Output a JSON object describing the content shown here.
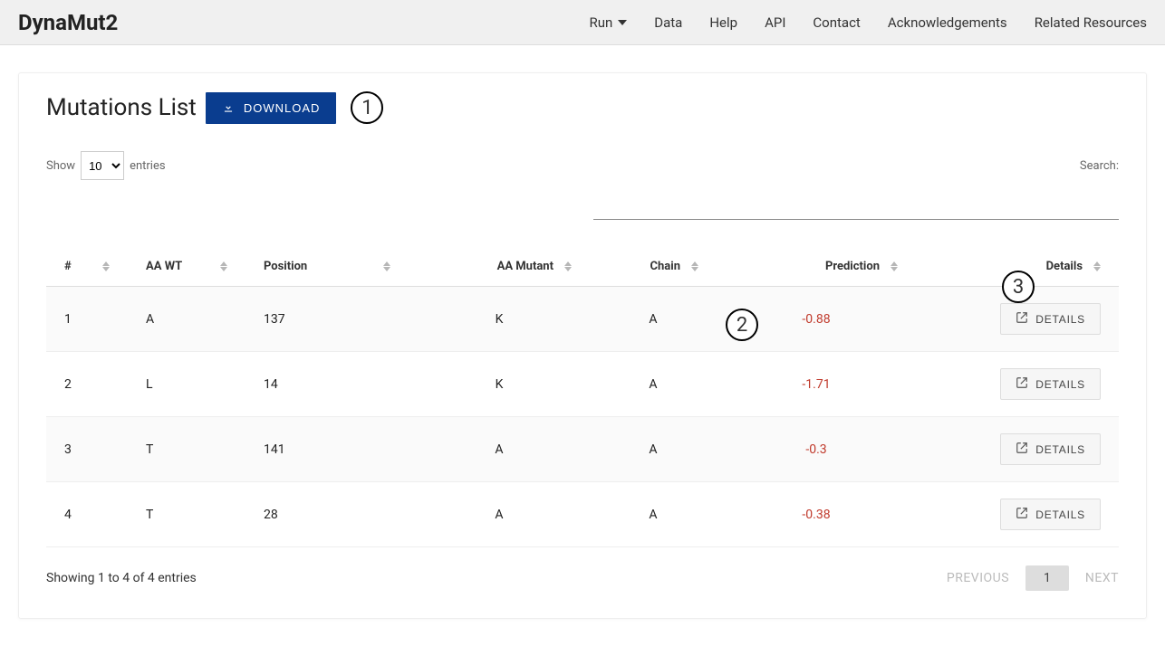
{
  "brand": "DynaMut2",
  "nav": {
    "run": "Run",
    "data": "Data",
    "help": "Help",
    "api": "API",
    "contact": "Contact",
    "ack": "Acknowledgements",
    "related": "Related Resources"
  },
  "card": {
    "title": "Mutations List",
    "download_label": "DOWNLOAD"
  },
  "annotations": {
    "a1": "1",
    "a2": "2",
    "a3": "3"
  },
  "controls": {
    "show_prefix": "Show",
    "show_value": "10",
    "show_suffix": "entries",
    "search_label": "Search:"
  },
  "columns": {
    "idx": "#",
    "aawt": "AA WT",
    "pos": "Position",
    "aamut": "AA Mutant",
    "chain": "Chain",
    "pred": "Prediction",
    "details": "Details"
  },
  "details_button_label": "DETAILS",
  "rows": [
    {
      "idx": "1",
      "aawt": "A",
      "pos": "137",
      "aamut": "K",
      "chain": "A",
      "pred": "-0.88"
    },
    {
      "idx": "2",
      "aawt": "L",
      "pos": "14",
      "aamut": "K",
      "chain": "A",
      "pred": "-1.71"
    },
    {
      "idx": "3",
      "aawt": "T",
      "pos": "141",
      "aamut": "A",
      "chain": "A",
      "pred": "-0.3"
    },
    {
      "idx": "4",
      "aawt": "T",
      "pos": "28",
      "aamut": "A",
      "chain": "A",
      "pred": "-0.38"
    }
  ],
  "footer": {
    "info": "Showing 1 to 4 of 4 entries",
    "prev": "PREVIOUS",
    "page": "1",
    "next": "NEXT"
  }
}
